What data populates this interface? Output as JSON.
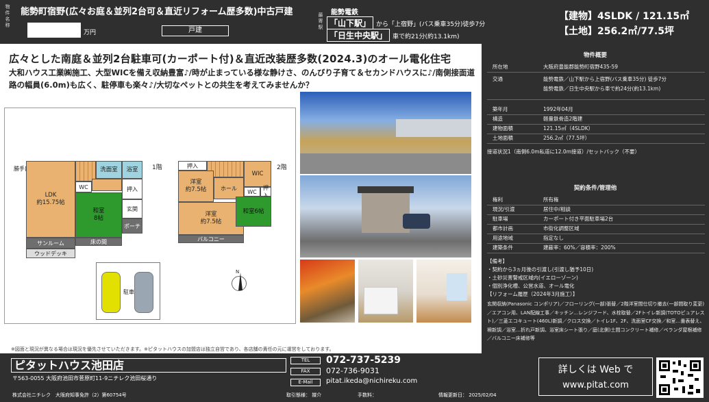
{
  "header": {
    "label_name": "物件名称",
    "title": "能勢町宿野(広々お庭＆並列2台可＆直近リフォーム歴多数)中古戸建",
    "price_unit": "万円",
    "property_type": "戸建",
    "label_station": "最寄駅",
    "line": "能勢電鉄",
    "station1": "「山下駅」",
    "station1_access": "から「上宿野」(バス乗車35分)徒歩7分",
    "station2": "「日生中央駅」",
    "station2_access": "車で約21分(約13.1km)",
    "building": "【建物】4SLDK / 121.15㎡",
    "land": "【土地】256.2㎡/77.5坪"
  },
  "main": {
    "catch": "広々とした南庭＆並列2台駐車可(カーポート付)＆直近改装歴多数(2024.3)のオール電化住宅",
    "desc": "大和ハウス工業㈱施工、大型WICを備え収納豊富♪/時が止まっている様な静けさ、のんびり子育て＆セカンドハウスに♪/南側接面道路の幅員(6.0m)も広く、駐停車も楽々♪/大切なペットとの共生を考えてみませんか？",
    "disclaimer": "※図面と現況が異なる場合は現況を優先させていただきます。※ピタットハウスの加盟店は独立自営であり、各店舗の責任の元に運営をしております。"
  },
  "plan": {
    "floor1": "1階",
    "floor2": "2階",
    "entry_label": "勝手口",
    "ldk": "LDK\n約15.75帖",
    "washroom": "洗面室",
    "bath": "浴室",
    "wc1": "WC",
    "storage1": "押入",
    "japanese8": "和室\n8帖",
    "genkan": "玄関",
    "porch": "ポーチ",
    "sunroom": "サンルーム",
    "wooddeck": "ウッドデッキ",
    "tokonoma": "床の間",
    "parking": "駐車",
    "west7": "洋室\n約7.5帖",
    "storage2a": "押入",
    "storage2b": "押入",
    "wic": "WIC",
    "hall": "ホール",
    "wc2": "WC",
    "west75": "洋室\n約7.5帖",
    "japanese6": "和室6帖",
    "balcony": "バルコニー",
    "north": "N"
  },
  "summary": {
    "title": "物件概要",
    "rows": [
      {
        "k": "所在地",
        "v": "大阪府豊能郡能勢町宿野435-59"
      },
      {
        "k": "交通",
        "v": "能勢電鉄／山下駅から上宿野(バス乗車35分) 徒歩7分"
      },
      {
        "k": "",
        "v": "能勢電鉄／日生中央駅から車で約24分(約13.1km)"
      },
      {
        "k": "築年月",
        "v": "1992年04月"
      },
      {
        "k": "構造",
        "v": "軽量鉄骨造2階建"
      },
      {
        "k": "建物面積",
        "v": "121.15㎡（4SLDK）"
      },
      {
        "k": "土地面積",
        "v": "256.2㎡（77.5坪）"
      }
    ],
    "road": "接道状況1（南側6.0m私道に12.0m接道）/セットバック（不要）"
  },
  "contract": {
    "title": "契約条件/管理他",
    "rows": [
      {
        "k": "権利",
        "v": "所有権"
      },
      {
        "k": "現況/引渡",
        "v": "居住中/相談"
      },
      {
        "k": "駐車場",
        "v": "カーポート付き平面駐車場2台"
      },
      {
        "k": "都市計画",
        "v": "市街化調整区域"
      },
      {
        "k": "用途地域",
        "v": "指定なし"
      },
      {
        "k": "建築条件",
        "v": "建蔽率：60%／容積率：200%"
      }
    ],
    "notes_title": "【備考】",
    "notes": [
      "・契約から3ヵ月後の引渡し(引渡し猶予10日)",
      "・土砂災害警戒区域内(イエローゾーン)",
      "・個別浄化槽、公営水道、オール電化",
      "【リフォーム履歴（2024年3月施工）】"
    ],
    "reform": "玄関収納(Panasonic コンポリア)／フローリング(一部)張替／2階洋室間仕切り撤去(一部間取り変更)／エアコン用、LAN配線工事／キッチン…レンジフード、水栓取替／2Fトイレ新調(TOTOピュアレスト)／三菱エコキュート(460L)新調／クロス交換／トイレ1F、2F、洗面室CF交換／和室…畳表替え、襖新調／浴室…折れ戸新調、浴室床シート張り／庭(北側)土間コンクリート補修／ベランダ屋根補修／バルコニー床補修等"
  },
  "footer": {
    "shop": "ピタットハウス池田店",
    "address": "〒563-0055 大阪府池田市菅原町11-9ニチレク池田桜通り",
    "company": "株式会社ニチレク　大阪府知事免許（2）第60754号",
    "tel_label": "TEL",
    "tel": "072-737-5239",
    "fax_label": "FAX",
    "fax": "072-736-9031",
    "mail_label": "E-Mail",
    "mail": "pitat.ikeda@nichireku.com",
    "deal_label": "取引態様：",
    "deal": "媒介",
    "fee_label": "手数料：",
    "updated_label": "情報更新日：",
    "updated": "2025/02/04",
    "web1": "詳しくは Web で",
    "web2": "www.pitat.com"
  }
}
